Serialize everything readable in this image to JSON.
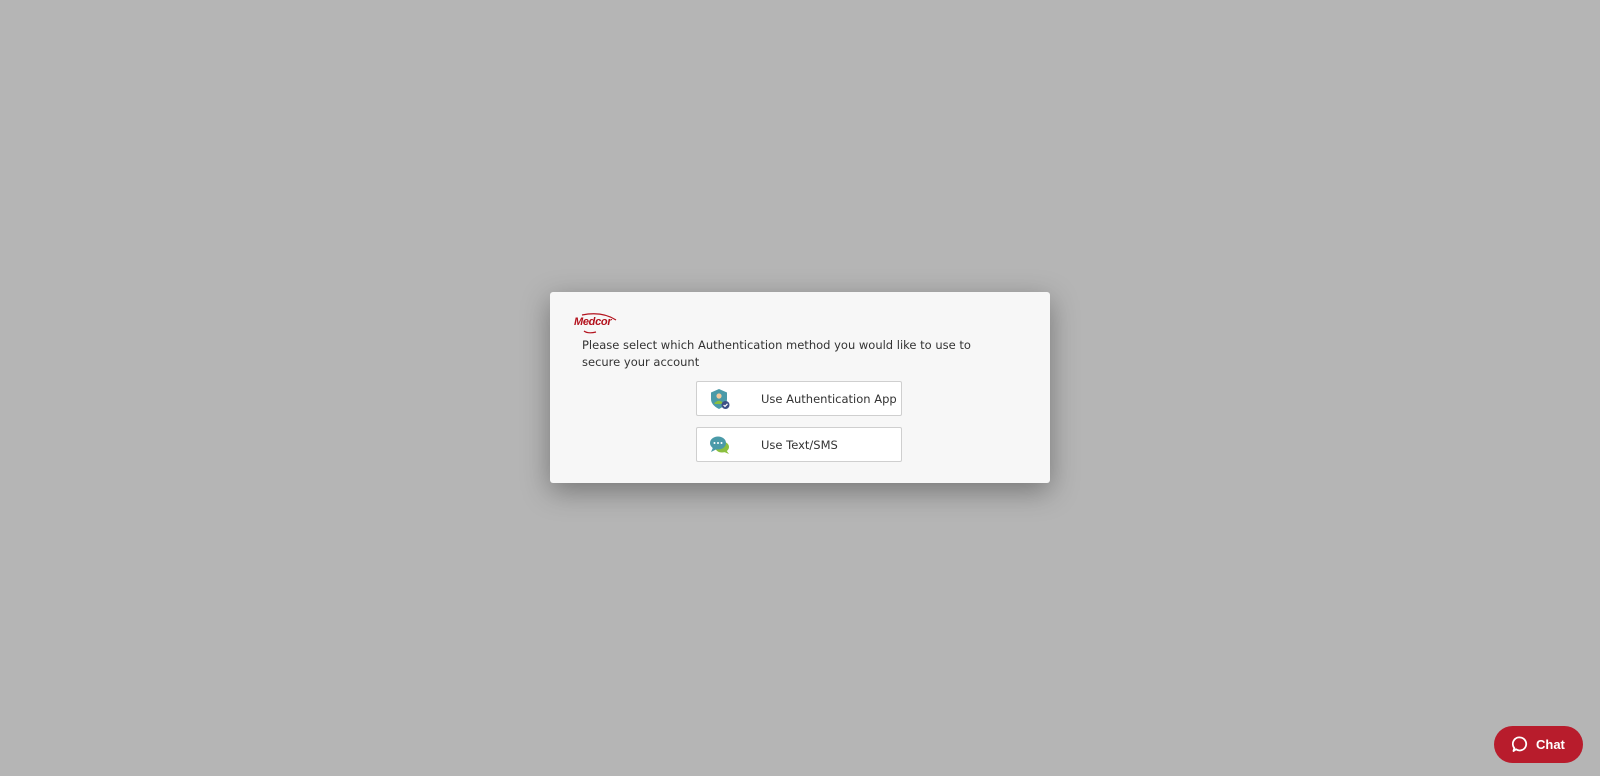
{
  "brand": {
    "logo_text": "Medcor",
    "color": "#b3121d"
  },
  "auth_dialog": {
    "prompt": "Please select which Authentication method you would like to use to secure your account",
    "options": [
      {
        "label": "Use Authentication App",
        "icon": "authenticator-shield-user-icon"
      },
      {
        "label": "Use Text/SMS",
        "icon": "chat-bubbles-icon"
      }
    ]
  },
  "chat_widget": {
    "label": "Chat",
    "icon": "speech-bubble-icon",
    "color": "#b81c2c"
  },
  "colors": {
    "backdrop": "#b5b5b5",
    "dialog_bg": "#f7f7f7",
    "teal_icon": "#4a9aa8",
    "green_icon": "#8bbf3f"
  }
}
